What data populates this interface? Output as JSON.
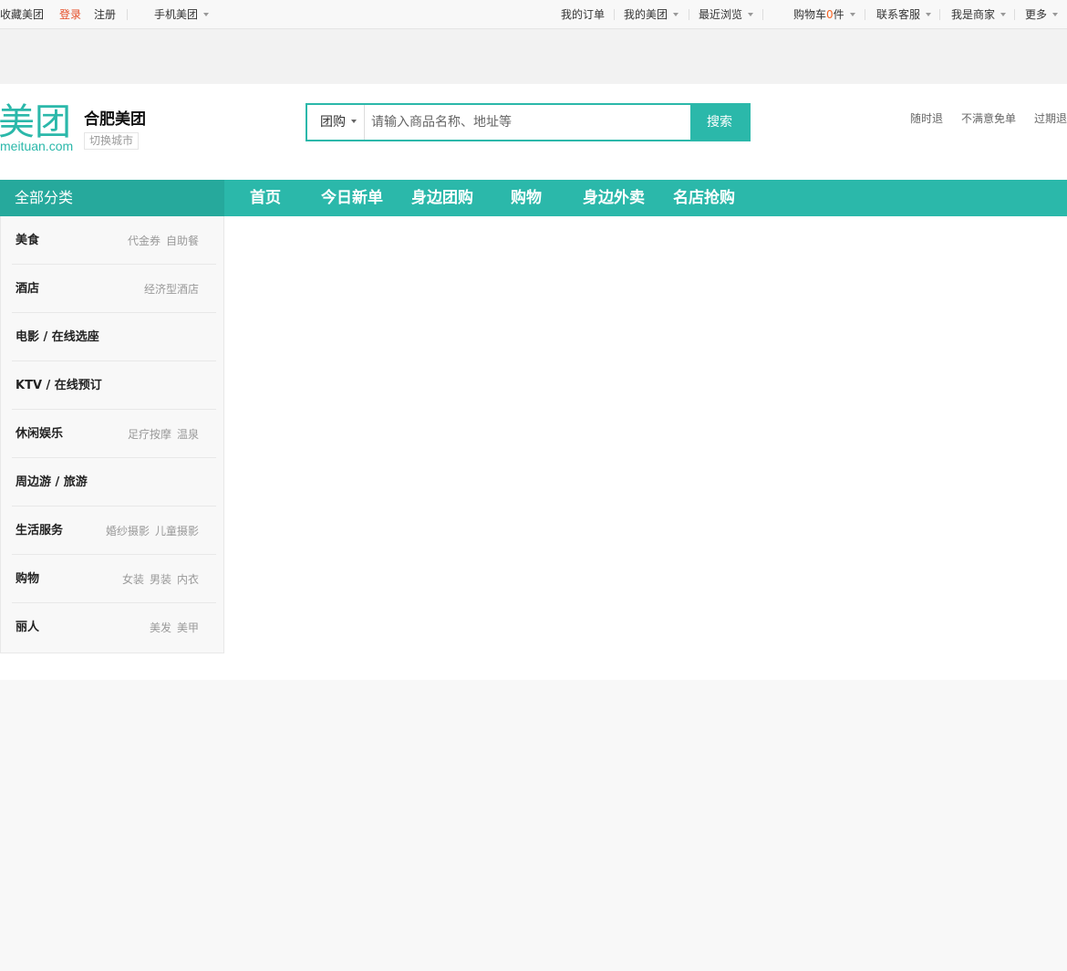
{
  "topbar": {
    "favorite": "收藏美团",
    "login": "登录",
    "register": "注册",
    "mobile": "手机美团",
    "orders": "我的订单",
    "my_meituan": "我的美团",
    "recent": "最近浏览",
    "cart_prefix": "购物车",
    "cart_count": "0",
    "cart_suffix": "件",
    "service": "联系客服",
    "merchant": "我是商家",
    "more": "更多"
  },
  "header": {
    "logo_text": "美团",
    "logo_url": "meituan.com",
    "city": "合肥美团",
    "switch_city": "切换城市",
    "search_type": "团购",
    "search_placeholder": "请输入商品名称、地址等",
    "search_button": "搜索",
    "guarantees": [
      "随时退",
      "不满意免单",
      "过期退"
    ]
  },
  "nav": {
    "all_categories": "全部分类",
    "items": [
      "首页",
      "今日新单",
      "身边团购",
      "购物",
      "身边外卖",
      "名店抢购"
    ]
  },
  "categories": [
    {
      "name": "美食",
      "tags": [
        "代金券",
        "自助餐"
      ]
    },
    {
      "name": "酒店",
      "tags": [
        "经济型酒店"
      ]
    },
    {
      "name": "电影 / 在线选座",
      "tags": []
    },
    {
      "name": "KTV / 在线预订",
      "tags": []
    },
    {
      "name": "休闲娱乐",
      "tags": [
        "足疗按摩",
        "温泉"
      ]
    },
    {
      "name": "周边游 / 旅游",
      "tags": []
    },
    {
      "name": "生活服务",
      "tags": [
        "婚纱摄影",
        "儿童摄影"
      ]
    },
    {
      "name": "购物",
      "tags": [
        "女装",
        "男装",
        "内衣"
      ]
    },
    {
      "name": "丽人",
      "tags": [
        "美发",
        "美甲"
      ]
    }
  ],
  "colors": {
    "brand": "#2bb8aa",
    "brand_dark": "#26a99c",
    "login": "#e54d26",
    "cart_count": "#f76120"
  }
}
